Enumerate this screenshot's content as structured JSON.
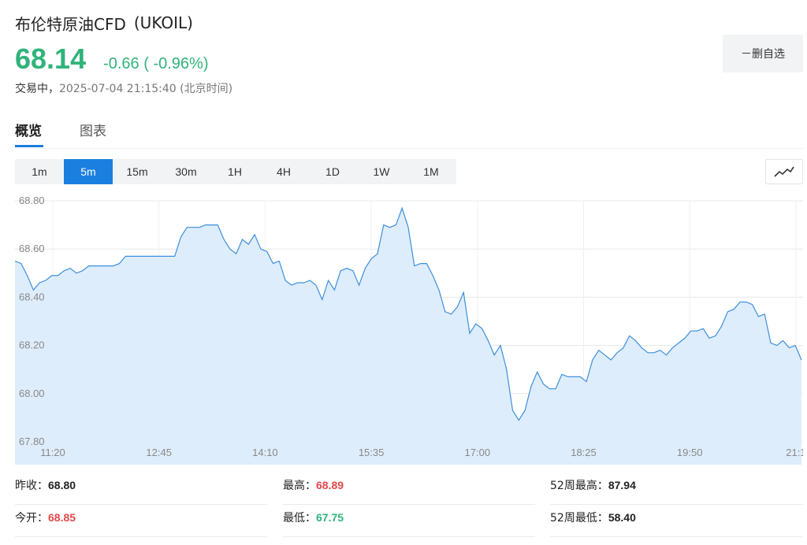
{
  "header": {
    "name": "布伦特原油CFD",
    "code": "(UKOIL)",
    "price": "68.14",
    "change": "-0.66 ( -0.96%)",
    "status_state": "交易中，",
    "status_time": "2025-07-04 21:15:40 (北京时间)",
    "watch_button": "－删自选"
  },
  "tabs": [
    {
      "label": "概览",
      "active": true
    },
    {
      "label": "图表",
      "active": false
    }
  ],
  "periods": [
    {
      "label": "1m",
      "active": false
    },
    {
      "label": "5m",
      "active": true
    },
    {
      "label": "15m",
      "active": false
    },
    {
      "label": "30m",
      "active": false
    },
    {
      "label": "1H",
      "active": false
    },
    {
      "label": "4H",
      "active": false
    },
    {
      "label": "1D",
      "active": false
    },
    {
      "label": "1W",
      "active": false
    },
    {
      "label": "1M",
      "active": false
    }
  ],
  "chart_type_icon": "line-chart-icon",
  "colors": {
    "down": "#30b37a",
    "up": "#e2474a",
    "accent": "#1b7fe0",
    "line": "#3d8fdc",
    "area": "#deedfb"
  },
  "chart_data": {
    "type": "area",
    "ylim": [
      67.8,
      68.8
    ],
    "yticks": [
      "68.80",
      "68.60",
      "68.40",
      "68.20",
      "68.00",
      "67.80"
    ],
    "xticks": [
      "11:20",
      "12:45",
      "14:10",
      "15:35",
      "17:00",
      "18:25",
      "19:50",
      "21:1"
    ],
    "grid": true,
    "values": [
      68.55,
      68.54,
      68.49,
      68.43,
      68.46,
      68.47,
      68.49,
      68.49,
      68.51,
      68.52,
      68.5,
      68.51,
      68.53,
      68.53,
      68.53,
      68.53,
      68.53,
      68.54,
      68.57,
      68.57,
      68.57,
      68.57,
      68.57,
      68.57,
      68.57,
      68.57,
      68.57,
      68.65,
      68.69,
      68.69,
      68.69,
      68.7,
      68.7,
      68.7,
      68.64,
      68.6,
      68.58,
      68.64,
      68.62,
      68.66,
      68.6,
      68.59,
      68.54,
      68.55,
      68.47,
      68.45,
      68.46,
      68.46,
      68.47,
      68.45,
      68.39,
      68.47,
      68.43,
      68.51,
      68.52,
      68.51,
      68.45,
      68.52,
      68.56,
      68.58,
      68.7,
      68.69,
      68.7,
      68.77,
      68.69,
      68.53,
      68.54,
      68.54,
      68.49,
      68.43,
      68.34,
      68.33,
      68.36,
      68.42,
      68.25,
      68.29,
      68.27,
      68.22,
      68.16,
      68.2,
      68.1,
      67.93,
      67.89,
      67.93,
      68.03,
      68.09,
      68.04,
      68.02,
      68.02,
      68.08,
      68.07,
      68.07,
      68.07,
      68.05,
      68.14,
      68.18,
      68.16,
      68.14,
      68.17,
      68.19,
      68.24,
      68.22,
      68.19,
      68.17,
      68.17,
      68.18,
      68.16,
      68.19,
      68.21,
      68.23,
      68.26,
      68.26,
      68.27,
      68.23,
      68.24,
      68.28,
      68.34,
      68.35,
      68.38,
      68.38,
      68.37,
      68.32,
      68.33,
      68.21,
      68.2,
      68.22,
      68.19,
      68.2,
      68.14
    ]
  },
  "stats": [
    {
      "label": "昨收：",
      "value": "68.80",
      "tone": "neutral"
    },
    {
      "label": "最高：",
      "value": "68.89",
      "tone": "up"
    },
    {
      "label": "52周最高：",
      "value": "87.94",
      "tone": "neutral"
    },
    {
      "label": "今开：",
      "value": "68.85",
      "tone": "up"
    },
    {
      "label": "最低：",
      "value": "67.75",
      "tone": "down"
    },
    {
      "label": "52周最低：",
      "value": "58.40",
      "tone": "neutral"
    }
  ]
}
